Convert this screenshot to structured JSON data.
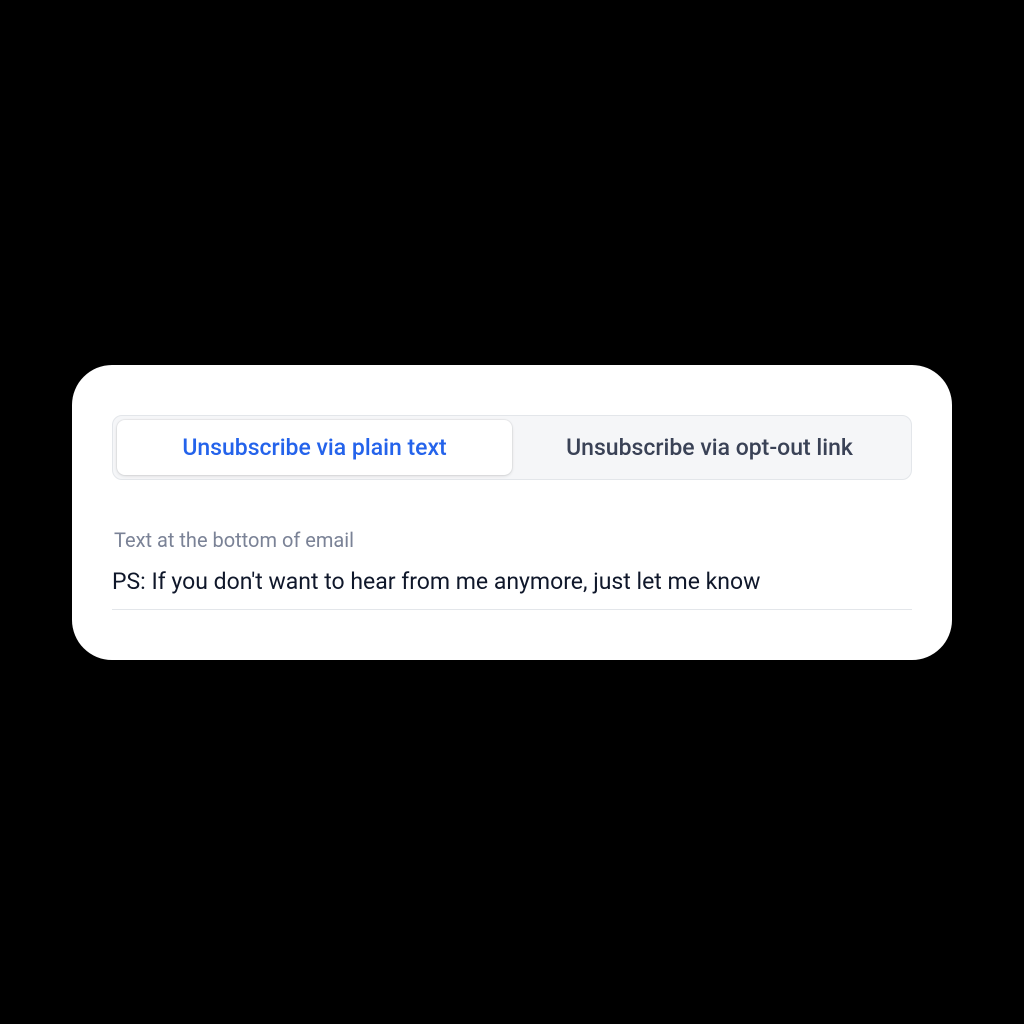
{
  "tabs": {
    "plain_text": "Unsubscribe via plain text",
    "optout_link": "Unsubscribe via opt-out link"
  },
  "field": {
    "label": "Text at the bottom of email",
    "value": "PS: If you don't want to hear from me anymore, just let me know"
  }
}
